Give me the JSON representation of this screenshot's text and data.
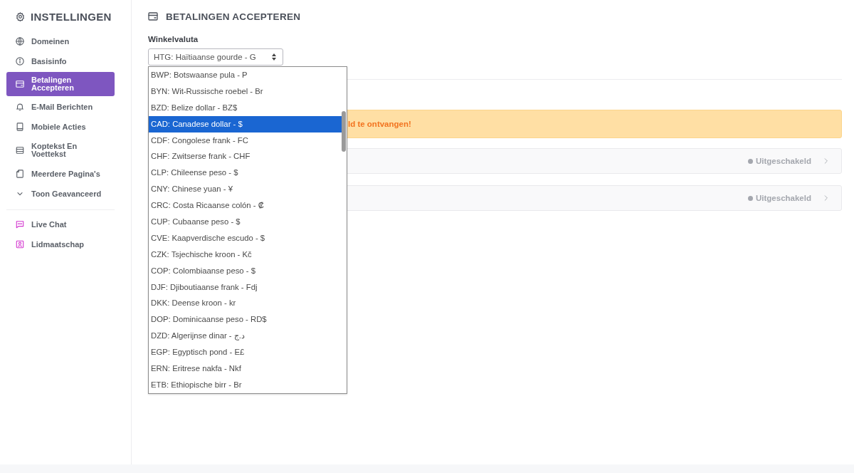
{
  "sidebar": {
    "title": "INSTELLINGEN",
    "items": [
      {
        "label": "Domeinen",
        "selected": false
      },
      {
        "label": "Basisinfo",
        "selected": false
      },
      {
        "label": "Betalingen Accepteren",
        "selected": true
      },
      {
        "label": "E-Mail Berichten",
        "selected": false
      },
      {
        "label": "Mobiele Acties",
        "selected": false
      },
      {
        "label": "Koptekst En Voettekst",
        "selected": false
      },
      {
        "label": "Meerdere Pagina's",
        "selected": false
      },
      {
        "label": "Toon Geavanceerd",
        "selected": false
      }
    ],
    "extra_items": [
      {
        "label": "Live Chat",
        "selected": false
      },
      {
        "label": "Lidmaatschap",
        "selected": false
      }
    ]
  },
  "page": {
    "title": "BETALINGEN ACCEPTEREN",
    "currency_field": {
      "label": "Winkelvaluta",
      "value": "HTG: Haïtiaanse gourde - G",
      "open": true,
      "options": [
        {
          "label": "BWP: Botswaanse pula - P",
          "selected": false
        },
        {
          "label": "BYN: Wit-Russische roebel - Br",
          "selected": false
        },
        {
          "label": "BZD: Belize dollar - BZ$",
          "selected": false
        },
        {
          "label": "CAD: Canadese dollar - $",
          "selected": true
        },
        {
          "label": "CDF: Congolese frank - FC",
          "selected": false
        },
        {
          "label": "CHF: Zwitserse frank - CHF",
          "selected": false
        },
        {
          "label": "CLP: Chileense peso - $",
          "selected": false
        },
        {
          "label": "CNY: Chinese yuan - ¥",
          "selected": false
        },
        {
          "label": "CRC: Costa Ricaanse colón - ₡",
          "selected": false
        },
        {
          "label": "CUP: Cubaanse peso - $",
          "selected": false
        },
        {
          "label": "CVE: Kaapverdische escudo - $",
          "selected": false
        },
        {
          "label": "CZK: Tsjechische kroon - Kč",
          "selected": false
        },
        {
          "label": "COP: Colombiaanse peso - $",
          "selected": false
        },
        {
          "label": "DJF: Djiboutiaanse frank - Fdj",
          "selected": false
        },
        {
          "label": "DKK: Deense kroon - kr",
          "selected": false
        },
        {
          "label": "DOP: Dominicaanse peso - RD$",
          "selected": false
        },
        {
          "label": "DZD: Algerijnse dinar - د.ج",
          "selected": false
        },
        {
          "label": "EGP: Egyptisch pond - E£",
          "selected": false
        },
        {
          "label": "ERN: Eritrese nakfa - Nkf",
          "selected": false
        },
        {
          "label": "ETB: Ethiopische birr - Br",
          "selected": false
        }
      ]
    },
    "banner": {
      "text": "ld te ontvangen!"
    },
    "rows": [
      {
        "status": "Uitgeschakeld"
      },
      {
        "status": "Uitgeschakeld"
      }
    ]
  }
}
